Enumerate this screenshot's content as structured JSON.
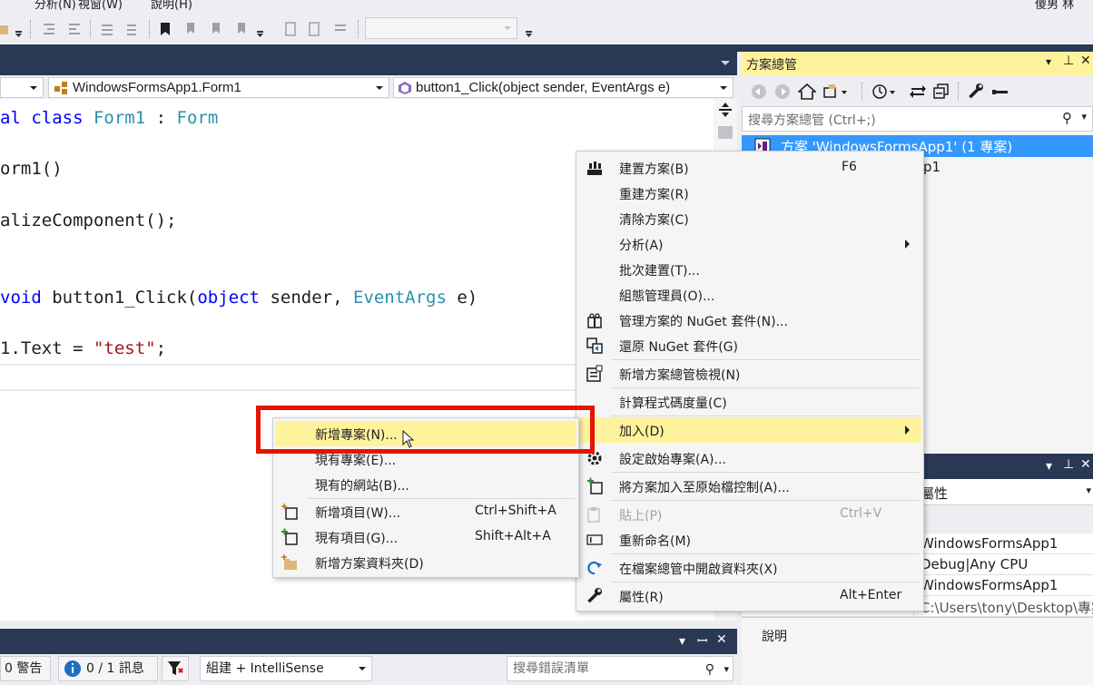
{
  "menubar": {
    "items": [
      "分析(N)",
      "視窗(W)",
      "說明(H)"
    ],
    "user": "傻男 林"
  },
  "editor": {
    "nav_project": "",
    "nav_class": "WindowsFormsApp1.Form1",
    "nav_member": "button1_Click(object sender, EventArgs e)",
    "code": {
      "l1a": "al ",
      "l1b": "class",
      "l1c": " ",
      "l1d": "Form1",
      "l1e": " : ",
      "l1f": "Form",
      "l2": "orm1()",
      "l3": "alizeComponent();",
      "l4a": "void",
      "l4b": " button1_Click(",
      "l4c": "object",
      "l4d": " sender, ",
      "l4e": "EventArgs",
      "l4f": " e)",
      "l5a": "1.Text = ",
      "l5b": "\"test\"",
      "l5c": ";"
    }
  },
  "errorlist": {
    "warnings": "0 警告",
    "messages": "0 / 1 訊息",
    "build_filter": "組建 + IntelliSense",
    "search_placeholder": "搜尋錯誤清單"
  },
  "solution_explorer": {
    "title": "方案總管",
    "search_placeholder": "搜尋方案總管 (Ctrl+;)",
    "solution_node": "方案 'WindowsFormsApp1' (1 專案)",
    "project_node_partial": "p1"
  },
  "properties": {
    "title_partial": "屬性",
    "rows": [
      {
        "value": "WindowsFormsApp1"
      },
      {
        "value": "Debug|Any CPU"
      },
      {
        "value": "WindowsFormsApp1"
      },
      {
        "value": "C:\\Users\\tony\\Desktop\\專案"
      }
    ],
    "desc_label": "說明"
  },
  "context_menu": {
    "items": [
      {
        "label": "建置方案(B)",
        "shortcut": "F6"
      },
      {
        "label": "重建方案(R)"
      },
      {
        "label": "清除方案(C)"
      },
      {
        "label": "分析(A)"
      },
      {
        "label": "批次建置(T)..."
      },
      {
        "label": "組態管理員(O)..."
      },
      {
        "label": "管理方案的 NuGet 套件(N)..."
      },
      {
        "label": "還原 NuGet 套件(G)"
      },
      {
        "label": "新增方案總管檢視(N)"
      },
      {
        "label": "計算程式碼度量(C)"
      },
      {
        "label": "加入(D)"
      },
      {
        "label": "設定啟始專案(A)..."
      },
      {
        "label": "將方案加入至原始檔控制(A)..."
      },
      {
        "label": "貼上(P)",
        "shortcut": "Ctrl+V"
      },
      {
        "label": "重新命名(M)"
      },
      {
        "label": "在檔案總管中開啟資料夾(X)"
      },
      {
        "label": "屬性(R)",
        "shortcut": "Alt+Enter"
      }
    ]
  },
  "add_submenu": {
    "items": [
      {
        "label": "新增專案(N)..."
      },
      {
        "label": "現有專案(E)..."
      },
      {
        "label": "現有的網站(B)..."
      },
      {
        "label": "新增項目(W)...",
        "shortcut": "Ctrl+Shift+A"
      },
      {
        "label": "現有項目(G)...",
        "shortcut": "Shift+Alt+A"
      },
      {
        "label": "新增方案資料夾(D)"
      }
    ]
  },
  "colors": {
    "highlight": "#fff29d",
    "selection": "#3399ff",
    "chrome_dark": "#293955",
    "annotation_red": "#e51400"
  }
}
